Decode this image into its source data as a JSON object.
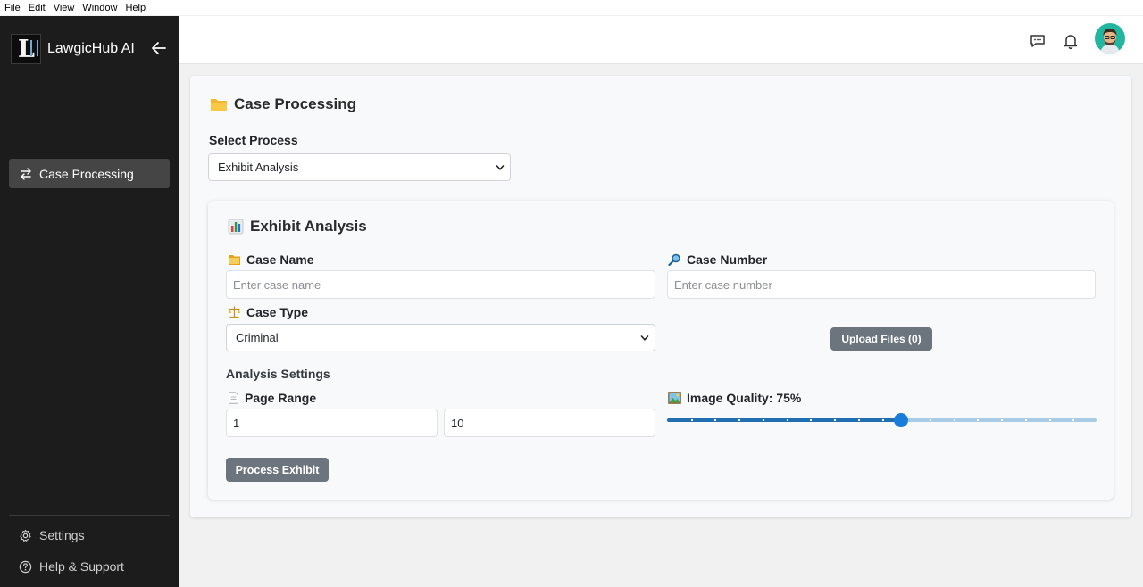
{
  "menubar": {
    "items": [
      "File",
      "Edit",
      "View",
      "Window",
      "Help"
    ]
  },
  "sidebar": {
    "brand": "LawgicHub AI",
    "nav": [
      {
        "label": "Case Processing",
        "icon": "arrows-swap-icon",
        "active": true
      }
    ],
    "footer": [
      {
        "label": "Settings",
        "icon": "gear-icon"
      },
      {
        "label": "Help & Support",
        "icon": "question-circle-icon"
      }
    ]
  },
  "header": {
    "icons": [
      "chat-icon",
      "bell-icon",
      "avatar"
    ]
  },
  "panel": {
    "title": "Case Processing",
    "select_process_label": "Select Process",
    "select_process_value": "Exhibit Analysis"
  },
  "exhibit": {
    "title": "Exhibit Analysis",
    "case_name_label": "Case Name",
    "case_name_placeholder": "Enter case name",
    "case_number_label": "Case Number",
    "case_number_placeholder": "Enter case number",
    "case_type_label": "Case Type",
    "case_type_value": "Criminal",
    "upload_label": "Upload Files (0)",
    "analysis_settings_label": "Analysis Settings",
    "page_range_label": "Page Range",
    "page_from": "1",
    "page_to": "10",
    "image_quality_label": "Image Quality: 75%",
    "image_quality_value": 75,
    "process_button": "Process Exhibit"
  },
  "colors": {
    "sidebar_bg": "#1c1c1c",
    "active_nav": "#454545",
    "button": "#6c757d",
    "slider": "#1a7cd9",
    "avatar_bg": "#22b5a0"
  }
}
